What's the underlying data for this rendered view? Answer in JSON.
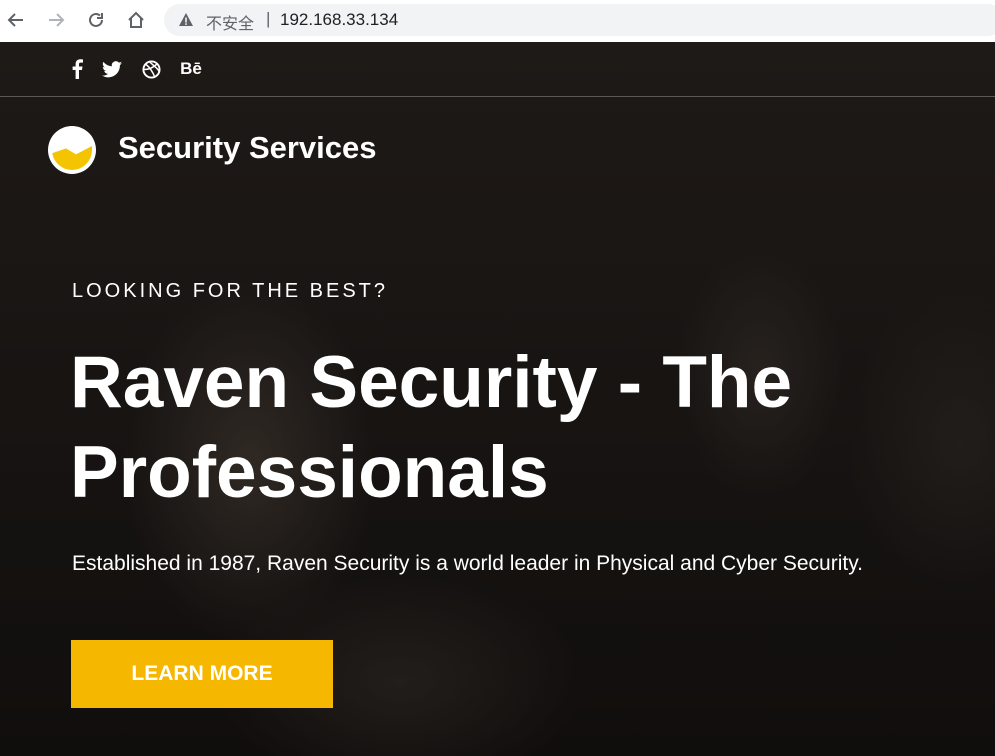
{
  "browser": {
    "insecure_label": "不安全",
    "separator": "|",
    "url": "192.168.33.134"
  },
  "social": {
    "facebook": "f",
    "twitter": "twitter-icon",
    "dribbble": "dribbble-icon",
    "behance": "Bē"
  },
  "brand": {
    "name": "Security Services",
    "logo_color": "#f5c400"
  },
  "hero": {
    "eyebrow": "LOOKING FOR THE BEST?",
    "headline_line1": "Raven Security - The",
    "headline_line2": "Professionals",
    "tagline": "Established in 1987, Raven Security is a world leader in Physical and Cyber Security.",
    "cta_label": "LEARN MORE",
    "cta_color": "#f5b700"
  }
}
